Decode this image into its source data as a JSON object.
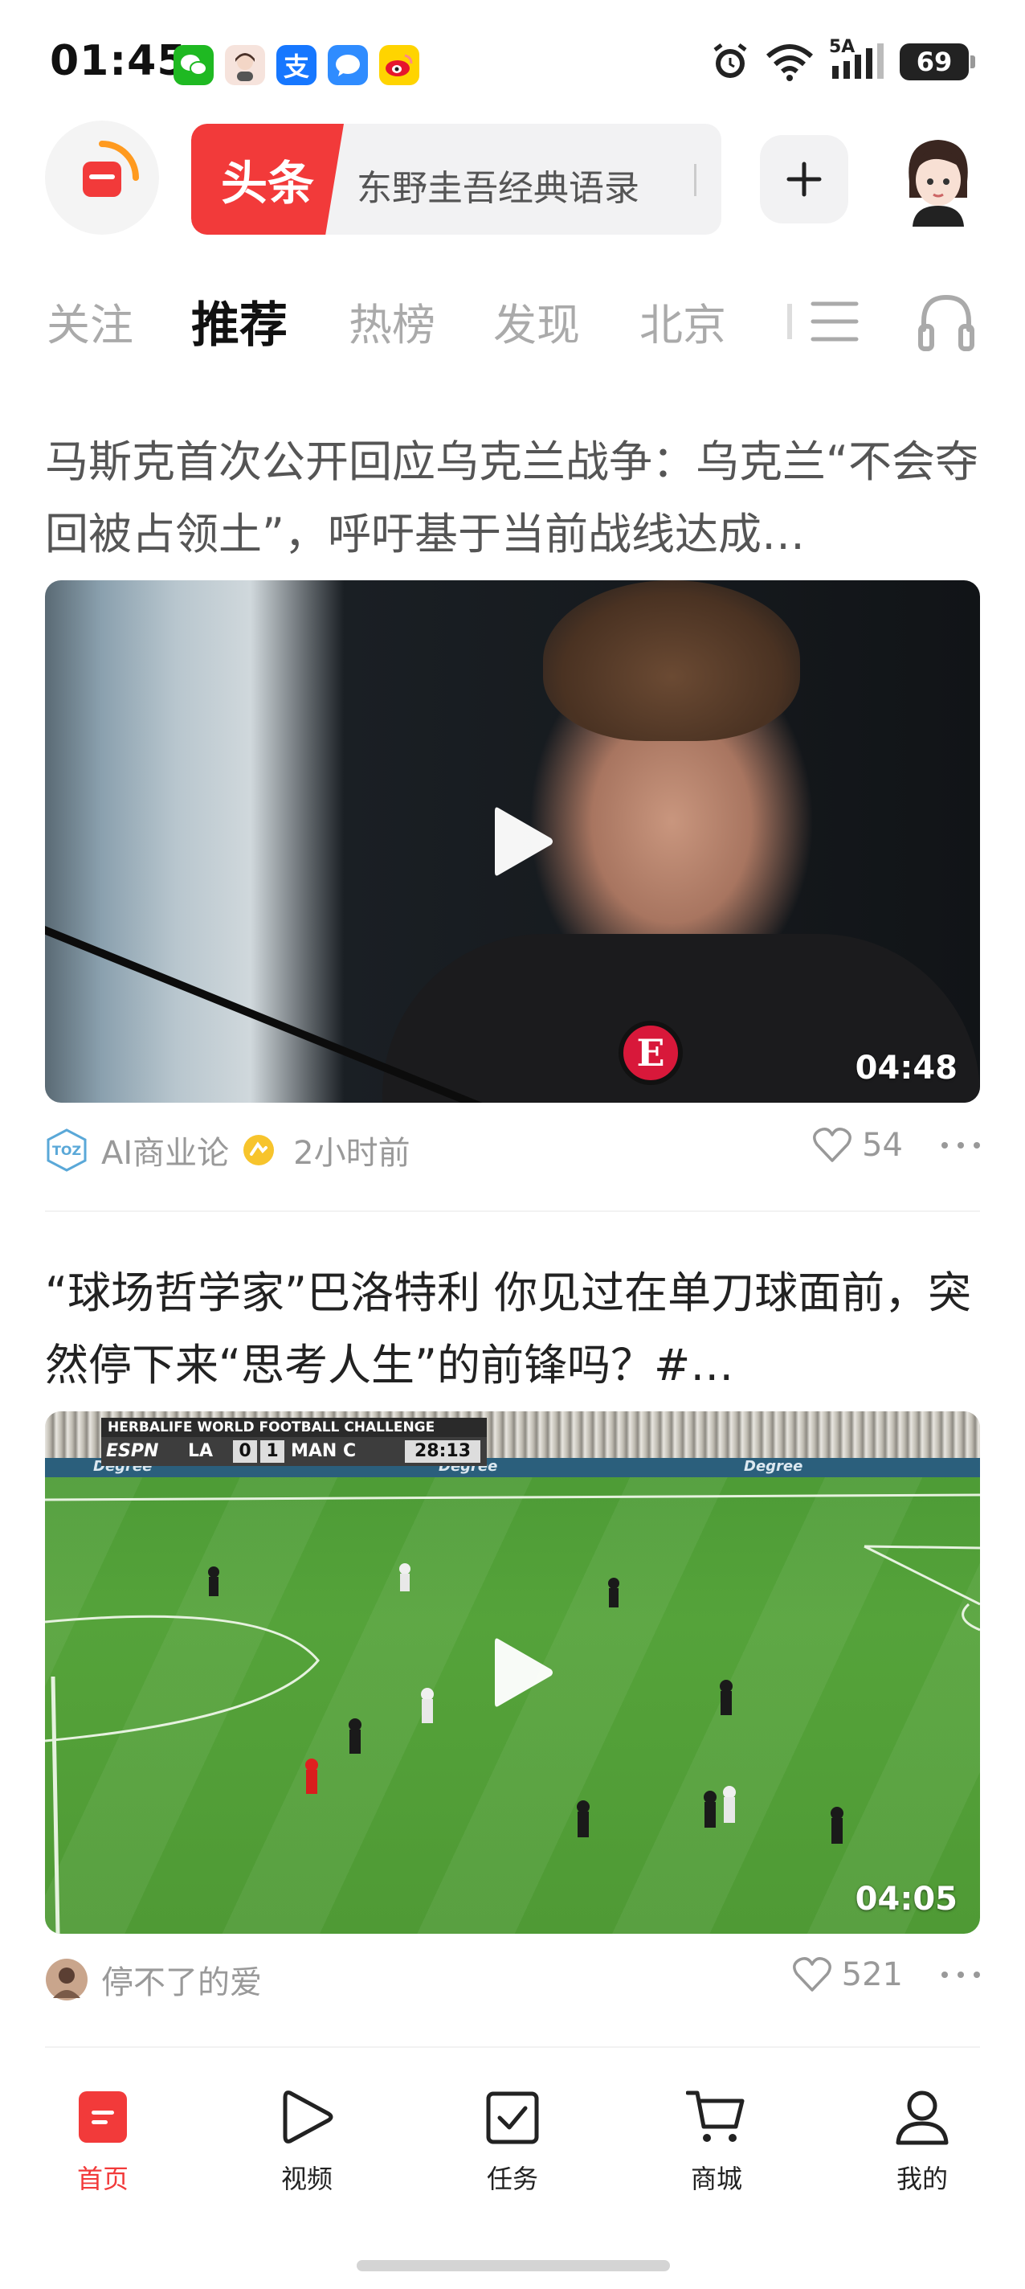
{
  "status_bar": {
    "time": "01:45",
    "network": "5A",
    "battery": "69"
  },
  "header": {
    "search_tag": "头条",
    "search_text": "东野圭吾经典语录"
  },
  "tabs": [
    {
      "label": "关注",
      "active": false
    },
    {
      "label": "推荐",
      "active": true
    },
    {
      "label": "热榜",
      "active": false
    },
    {
      "label": "发现",
      "active": false
    },
    {
      "label": "北京",
      "active": false
    }
  ],
  "articles": [
    {
      "title": "马斯克首次公开回应乌克兰战争：乌克兰“不会夺回被占领土”，呼吁基于当前战线达成…",
      "duration": "04:48",
      "source": "AI商业论",
      "source_icon_text": "TOZ",
      "time": "2小时前",
      "likes": "54",
      "thumb_badge": "E"
    },
    {
      "title": "“球场哲学家”巴洛特利 你见过在单刀球面前，突然停下来“思考人生”的前锋吗？#…",
      "duration": "04:05",
      "source": "停不了的爱",
      "likes": "521",
      "scoreboard": {
        "event": "HERBALIFE WORLD FOOTBALL CHALLENGE",
        "broadcaster": "ESPN",
        "home": "LA",
        "home_score": "0",
        "away_score": "1",
        "away": "MAN C",
        "clock": "28:13",
        "ad_text": "Degree"
      }
    }
  ],
  "bottom_nav": [
    {
      "label": "首页",
      "icon": "home-icon",
      "active": true
    },
    {
      "label": "视频",
      "icon": "video-play-icon",
      "active": false
    },
    {
      "label": "任务",
      "icon": "task-check-icon",
      "active": false
    },
    {
      "label": "商城",
      "icon": "shopping-cart-icon",
      "active": false
    },
    {
      "label": "我的",
      "icon": "profile-icon",
      "active": false
    }
  ],
  "colors": {
    "brand_red": "#f23a3a",
    "muted_text": "#999999",
    "inactive_tab": "#aaaaaa"
  }
}
